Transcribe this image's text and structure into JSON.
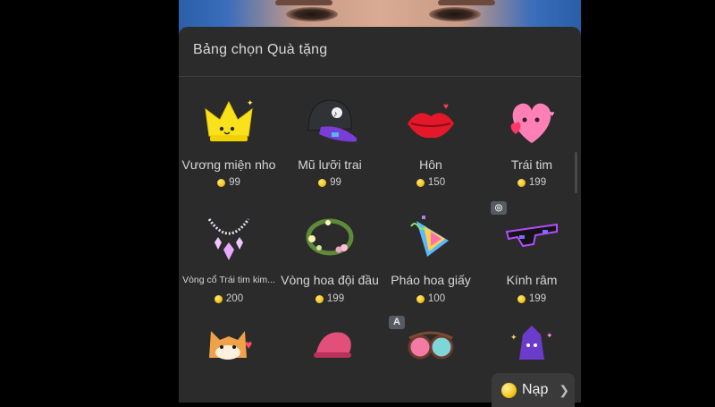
{
  "panel": {
    "title": "Bảng chọn Quà tặng"
  },
  "gifts": [
    {
      "name": "Vương miện nho",
      "price": "99",
      "icon": "crown-icon"
    },
    {
      "name": "Mũ lưỡi trai",
      "price": "99",
      "icon": "cap-icon"
    },
    {
      "name": "Hôn",
      "price": "150",
      "icon": "lips-icon"
    },
    {
      "name": "Trái tim",
      "price": "199",
      "icon": "heart-icon"
    },
    {
      "name": "Vòng cổ Trái tim kim...",
      "price": "200",
      "icon": "necklace-icon"
    },
    {
      "name": "Vòng hoa đội đầu",
      "price": "199",
      "icon": "flower-wreath-icon"
    },
    {
      "name": "Pháo hoa giấy",
      "price": "100",
      "icon": "party-popper-icon"
    },
    {
      "name": "Kính râm",
      "price": "199",
      "icon": "sunglasses-icon"
    },
    {
      "icon": "corgi-icon"
    },
    {
      "icon": "pink-hat-icon"
    },
    {
      "icon": "glasses-gift-icon"
    },
    {
      "icon": "purple-character-icon"
    }
  ],
  "badges": {
    "ar_badge": "A"
  },
  "recharge": {
    "label": "Nạp"
  },
  "colors": {
    "panel_bg": "#2b2b2b",
    "coin": "#f5c518",
    "text": "#d6d6d6"
  }
}
